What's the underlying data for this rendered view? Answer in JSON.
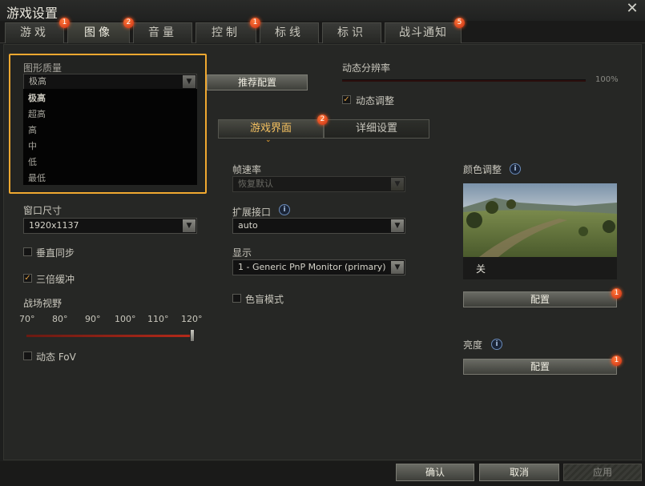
{
  "window": {
    "title": "游戏设置",
    "close_glyph": "✕"
  },
  "tabs": [
    {
      "label": "游戏",
      "badge": "1",
      "active": false
    },
    {
      "label": "图像",
      "badge": "2",
      "active": true
    },
    {
      "label": "音量",
      "badge": "",
      "active": false
    },
    {
      "label": "控制",
      "badge": "1",
      "active": false
    },
    {
      "label": "标线",
      "badge": "",
      "active": false
    },
    {
      "label": "标识",
      "badge": "",
      "active": false
    },
    {
      "label": "战斗通知",
      "badge": "5",
      "active": false
    }
  ],
  "graphics_quality": {
    "label": "图形质量",
    "selected": "极高",
    "options": [
      "极高",
      "超高",
      "高",
      "中",
      "低",
      "最低"
    ],
    "recommend_button": "推荐配置"
  },
  "dynamic_resolution": {
    "label": "动态分辨率",
    "value": "100%",
    "auto_adjust_label": "动态调整",
    "auto_adjust_checked": true
  },
  "subtabs": {
    "game_ui": "游戏界面",
    "game_ui_badge": "2",
    "detail": "详细设置"
  },
  "window_size": {
    "label": "窗口尺寸",
    "value": "1920x1137"
  },
  "vsync": {
    "label": "垂直同步",
    "checked": false
  },
  "triple_buffer": {
    "label": "三倍缓冲",
    "checked": true
  },
  "fov": {
    "label": "战场视野",
    "ticks": [
      "70°",
      "80°",
      "90°",
      "100°",
      "110°",
      "120°"
    ],
    "value_fraction": 1.0,
    "dynamic_label": "动态 FoV",
    "dynamic_checked": false
  },
  "frame_rate": {
    "label": "帧速率",
    "value": "恢复默认"
  },
  "extension": {
    "label": "扩展接口",
    "value": "auto"
  },
  "display": {
    "label": "显示",
    "value": "1 - Generic PnP Monitor (primary)"
  },
  "colorblind": {
    "label": "色盲模式",
    "checked": false
  },
  "color_adjust": {
    "label": "颜色调整",
    "preview_caption": "关",
    "config_button": "配置",
    "badge": "1"
  },
  "brightness": {
    "label": "亮度",
    "config_button": "配置",
    "badge": "1"
  },
  "footer": {
    "ok": "确认",
    "cancel": "取消",
    "apply": "应用"
  },
  "colors": {
    "accent_orange": "#f0a830",
    "badge_red": "#d83a18"
  }
}
